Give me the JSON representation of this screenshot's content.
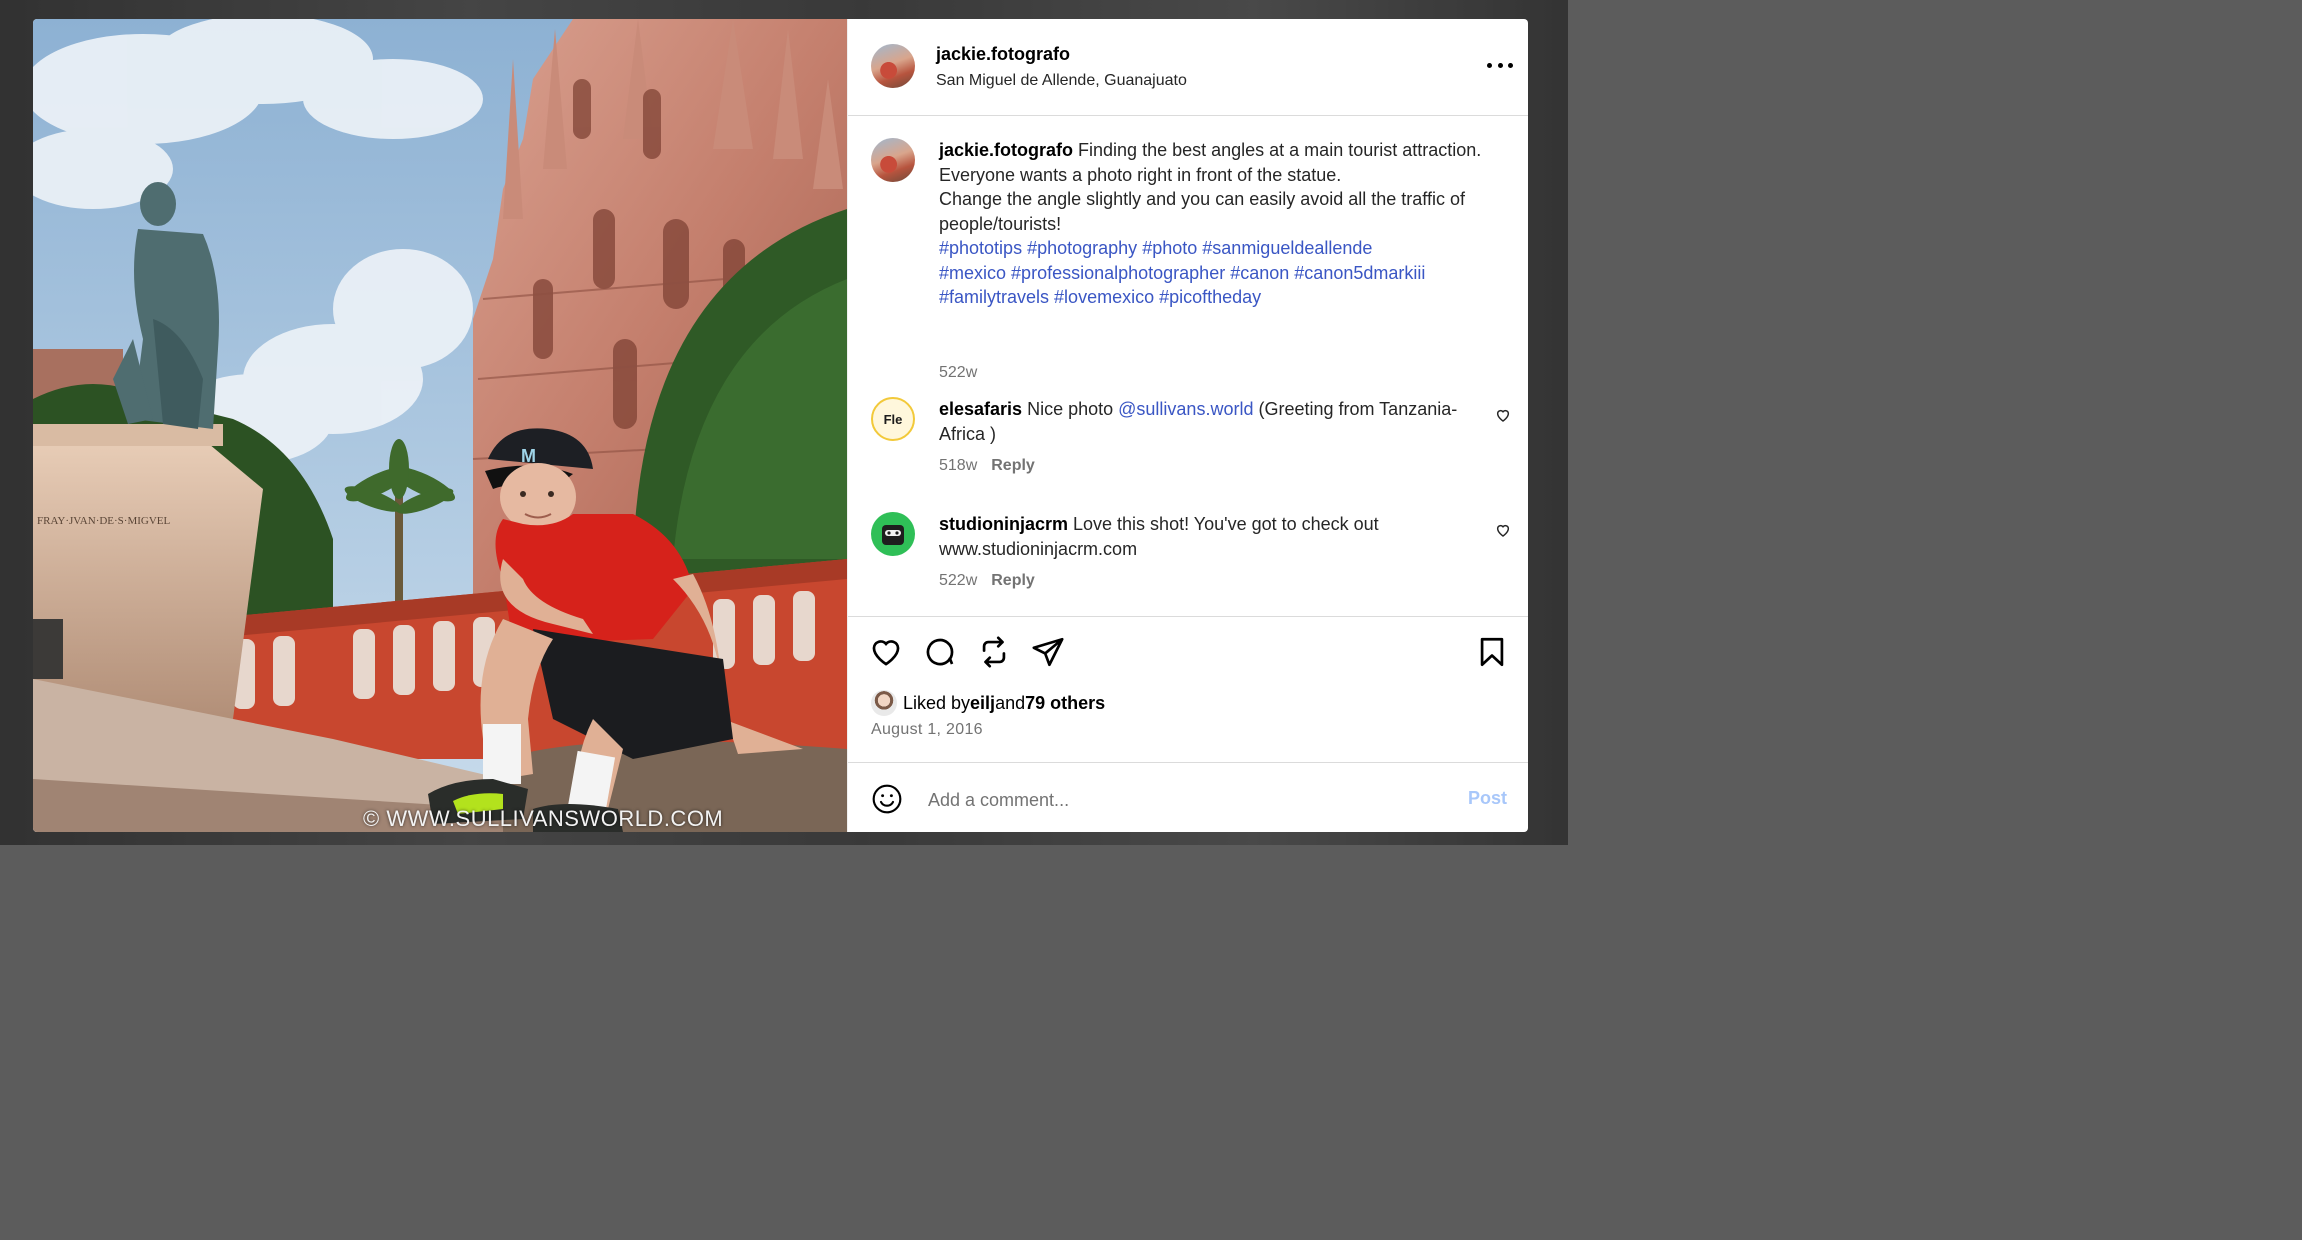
{
  "post": {
    "username": "jackie.fotografo",
    "location": "San Miguel de Allende, Guanajuato",
    "watermark": "© WWW.SULLIVANSWORLD.COM"
  },
  "caption": {
    "username": "jackie.fotografo",
    "line1": " Finding the best angles at a main tourist attraction.",
    "line2": "Everyone wants a photo right in front of the statue.",
    "line3": "Change the angle slightly and you can easily avoid all the traffic of people/tourists!",
    "hashtags": [
      "#phototips",
      "#photography",
      "#photo",
      "#sanmigueldeallende",
      "#mexico",
      "#professionalphotographer",
      "#canon",
      "#canon5dmarkiii",
      "#familytravels",
      "#lovemexico",
      "#picoftheday"
    ],
    "age": "522w"
  },
  "comments": [
    {
      "username": "elesafaris",
      "text_before": " Nice photo ",
      "mention": "@sullivans.world",
      "text_after": " (Greeting from Tanzania-Africa )",
      "age": "518w",
      "reply": "Reply",
      "avatar_text": "Fle"
    },
    {
      "username": "studioninjacrm",
      "text_before": " Love this shot! You've got to check out www.studioninjacrm.com",
      "age": "522w",
      "reply": "Reply"
    }
  ],
  "likes": {
    "prefix": "Liked by ",
    "user": "eilj",
    "middle": " and ",
    "others": "79 others"
  },
  "date": "August 1, 2016",
  "add_comment": {
    "placeholder": "Add a comment...",
    "post_label": "Post"
  },
  "statue_inscription": "FRAY·JVAN·DE·S·MIGVEL",
  "icons": [
    "more-options-icon",
    "heart-icon",
    "comment-icon",
    "repost-icon",
    "share-icon",
    "bookmark-icon",
    "emoji-icon"
  ],
  "colors": {
    "hashtag": "#3a56c4",
    "post_button": "#a8c7fa",
    "muted": "#737373",
    "divider": "#dbdbdb"
  }
}
